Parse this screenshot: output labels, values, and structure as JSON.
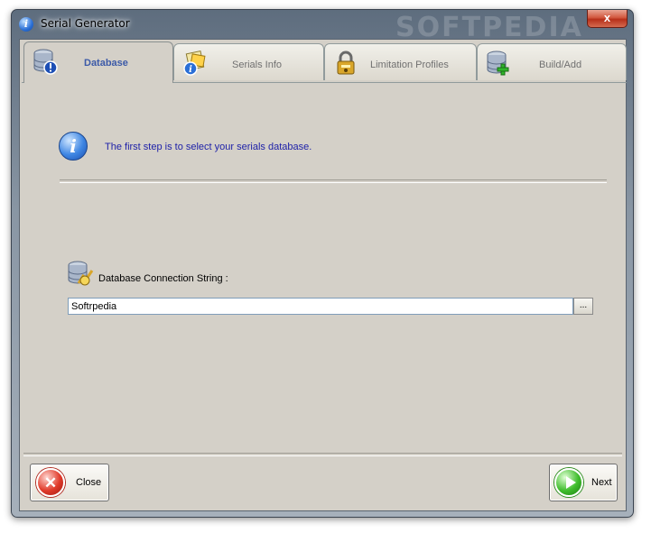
{
  "window": {
    "title": "Serial Generator",
    "close_glyph": "x",
    "watermark": "SOFTPEDIA"
  },
  "tabs": [
    {
      "label": "Database",
      "icon": "database-warning-icon",
      "active": true
    },
    {
      "label": "Serials Info",
      "icon": "serials-info-icon",
      "active": false
    },
    {
      "label": "Limitation Profiles",
      "icon": "lock-profile-icon",
      "active": false
    },
    {
      "label": "Build/Add",
      "icon": "database-add-icon",
      "active": false
    }
  ],
  "info": {
    "icon": "info-icon",
    "text": "The first step is to select your serials database."
  },
  "connection": {
    "icon": "database-connection-icon",
    "label": "Database Connection String :",
    "value": "Softrpedia",
    "browse_label": "..."
  },
  "buttons": {
    "close_label": "Close",
    "next_label": "Next"
  },
  "colors": {
    "accent_text": "#1c1fa8",
    "active_tab_text": "#3c5aa8",
    "panel": "#d4d0c8"
  }
}
